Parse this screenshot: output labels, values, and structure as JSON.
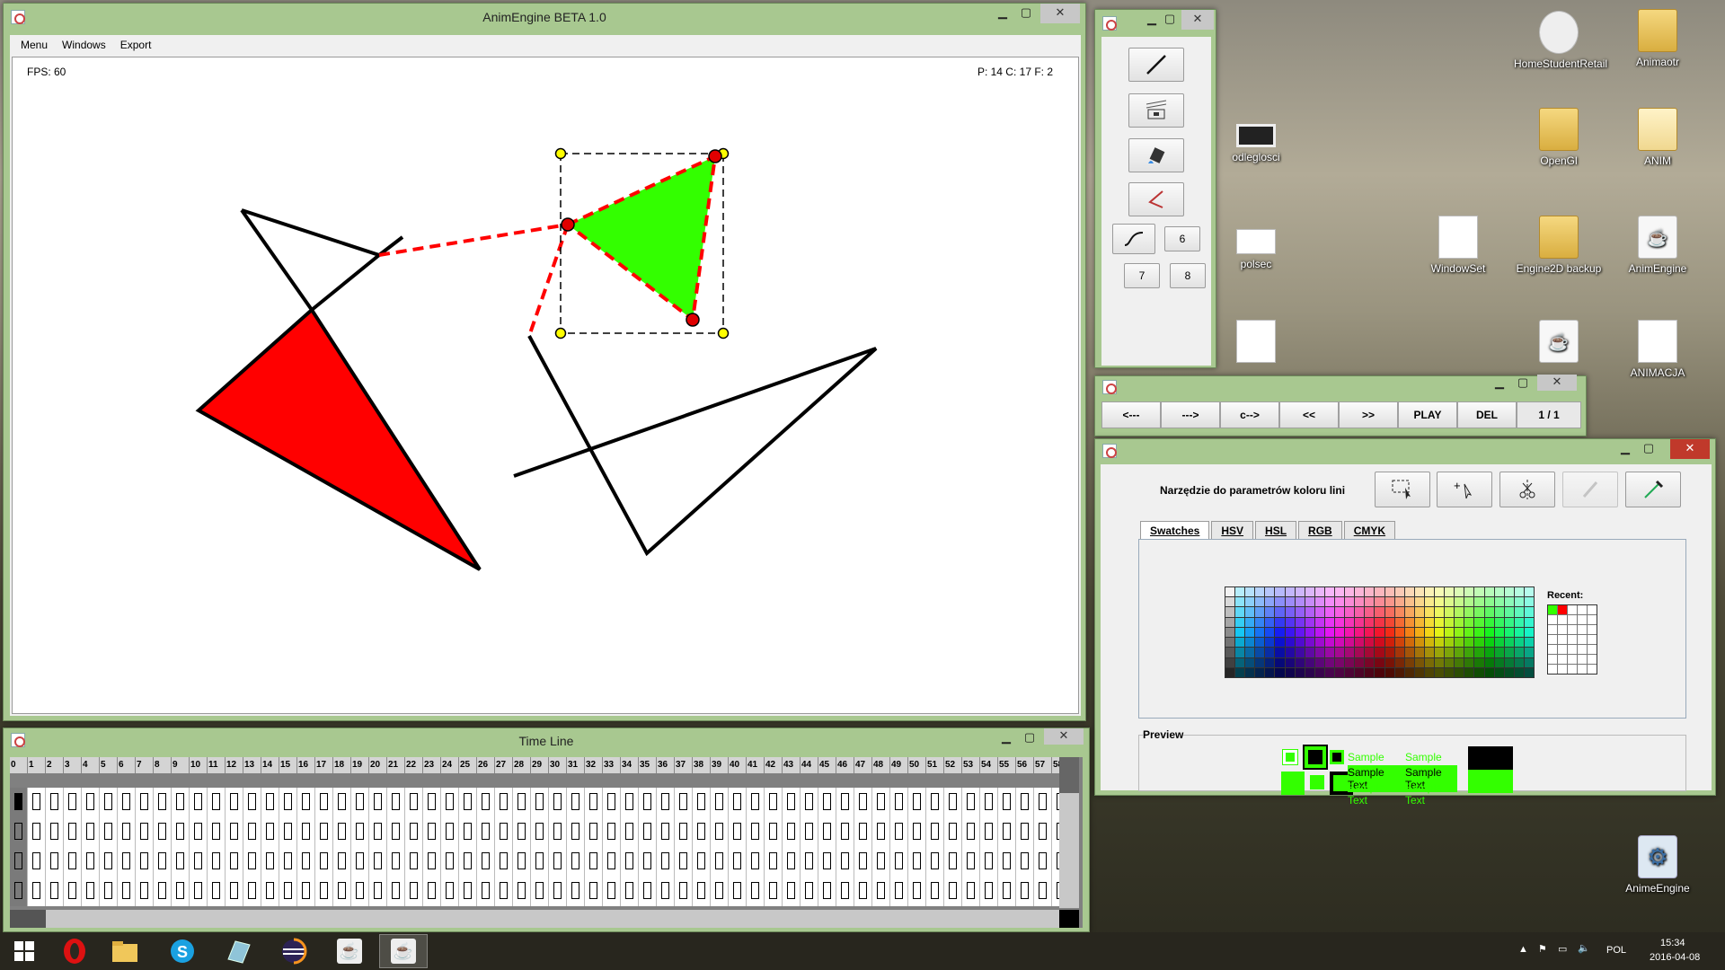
{
  "main": {
    "title": "AnimEngine BETA 1.0",
    "menu": [
      "Menu",
      "Windows",
      "Export"
    ],
    "fps": "FPS: 60",
    "stats": "P: 14 C: 17 F: 2"
  },
  "tools": {
    "btn6": "6",
    "btn7": "7",
    "btn8": "8"
  },
  "player": {
    "buttons": [
      "<---",
      "--->",
      "c-->",
      "<<",
      ">>",
      "PLAY",
      "DEL"
    ],
    "frame": "1 / 1"
  },
  "color": {
    "label": "Narzędzie do parametrów koloru lini",
    "tabs": [
      "Swatches",
      "HSV",
      "HSL",
      "RGB",
      "CMYK"
    ],
    "recent": "Recent:",
    "preview": "Preview",
    "sample": "Sample Text",
    "colors": {
      "fill": "#33ff00",
      "stroke": "#ff0000",
      "accent": "#a8c890"
    }
  },
  "timeline": {
    "title": "Time Line",
    "frames": [
      "0",
      "1",
      "2",
      "3",
      "4",
      "5",
      "6",
      "7",
      "8",
      "9",
      "10",
      "11",
      "12",
      "13",
      "14",
      "15",
      "16",
      "17",
      "18",
      "19",
      "20",
      "21",
      "22",
      "23",
      "24",
      "25",
      "26",
      "27",
      "28",
      "29",
      "30",
      "31",
      "32",
      "33",
      "34",
      "35",
      "36",
      "37",
      "38",
      "39",
      "40",
      "41",
      "42",
      "43",
      "44",
      "45",
      "46",
      "47",
      "48",
      "49",
      "50",
      "51",
      "52",
      "53",
      "54",
      "55",
      "56",
      "57",
      "58"
    ]
  },
  "desktop": {
    "icons": [
      "HomeStudentRetail",
      "Animaotr",
      "odleglosci",
      "OpenGl",
      "ANIM",
      "polsec",
      "WindowSet",
      "Engine2D backup",
      "AnimEngine",
      "ANIMACJA",
      "AnimeEngine"
    ]
  },
  "taskbar": {
    "lang": "POL",
    "time": "15:34",
    "date": "2016-04-08",
    "apps": [
      "windows-start",
      "opera",
      "file-explorer",
      "skype",
      "pen-app",
      "eclipse",
      "java-app",
      "java-app-active"
    ]
  }
}
